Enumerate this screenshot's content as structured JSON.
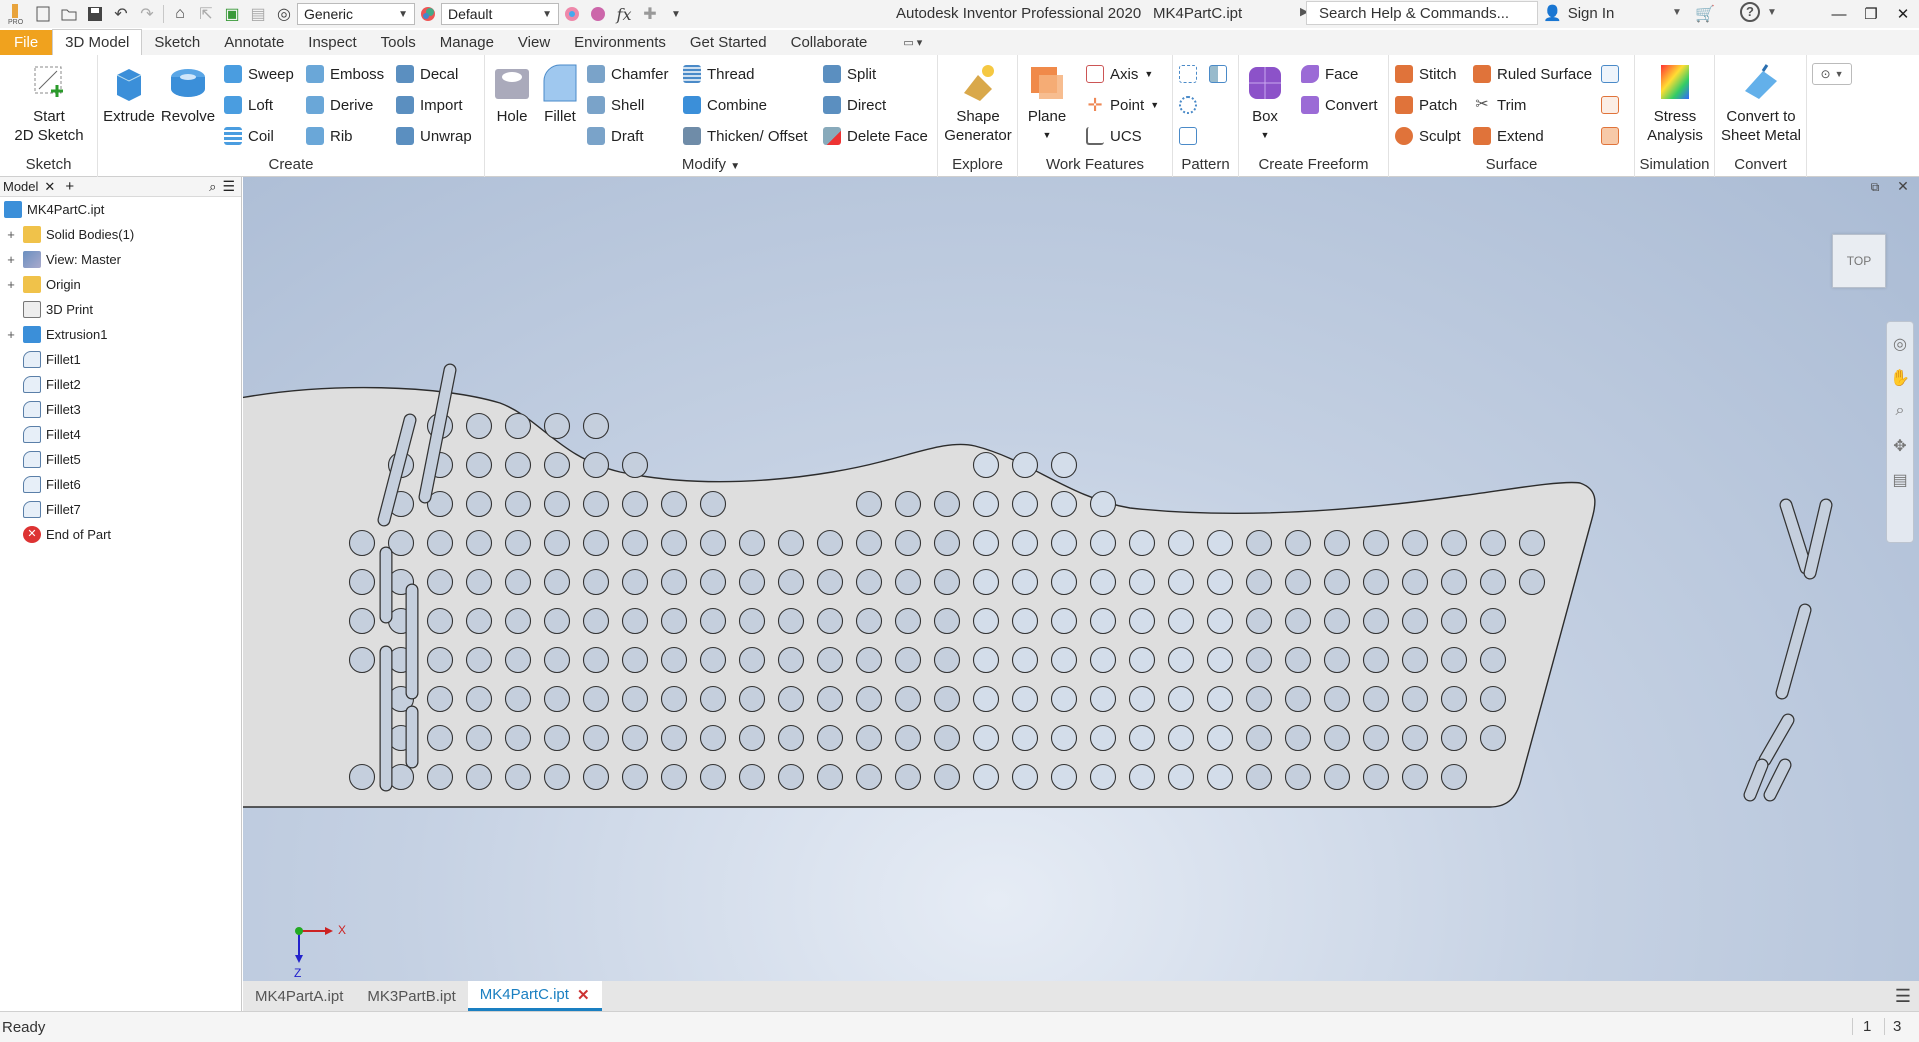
{
  "titlebar": {
    "app_icon": "inventor-logo-icon",
    "style_dropdown": "Generic",
    "appearance_dropdown": "Default",
    "app_title": "Autodesk Inventor Professional 2020",
    "doc_title": "MK4PartC.ipt",
    "search_placeholder": "Search Help & Commands...",
    "signin": "Sign In"
  },
  "tabs": [
    "File",
    "3D Model",
    "Sketch",
    "Annotate",
    "Inspect",
    "Tools",
    "Manage",
    "View",
    "Environments",
    "Get Started",
    "Collaborate"
  ],
  "active_tab": "3D Model",
  "ribbon": {
    "sketch": {
      "title": "Sketch",
      "start": "Start",
      "start2": "2D Sketch"
    },
    "create": {
      "title": "Create",
      "extrude": "Extrude",
      "revolve": "Revolve",
      "col1": [
        "Sweep",
        "Loft",
        "Coil"
      ],
      "col2": [
        "Emboss",
        "Derive",
        "Rib"
      ],
      "col3": [
        "Decal",
        "Import",
        "Unwrap"
      ]
    },
    "modify": {
      "title": "Modify",
      "hole": "Hole",
      "fillet": "Fillet",
      "col1": [
        "Chamfer",
        "Shell",
        "Draft"
      ],
      "col2": [
        "Thread",
        "Combine",
        "Thicken/ Offset"
      ],
      "col3": [
        "Split",
        "Direct",
        "Delete Face"
      ]
    },
    "explore": {
      "title": "Explore",
      "shape1": "Shape",
      "shape2": "Generator"
    },
    "work": {
      "title": "Work Features",
      "plane": "Plane",
      "col": [
        "Axis",
        "Point",
        "UCS"
      ]
    },
    "pattern": {
      "title": "Pattern"
    },
    "freeform": {
      "title": "Create Freeform",
      "box": "Box",
      "col": [
        "Face",
        "Convert"
      ]
    },
    "surface": {
      "title": "Surface",
      "col1": [
        "Stitch",
        "Patch",
        "Sculpt"
      ],
      "col2": [
        "Ruled Surface",
        "Trim",
        "Extend"
      ]
    },
    "simulation": {
      "title": "Simulation",
      "l1": "Stress",
      "l2": "Analysis"
    },
    "convert": {
      "title": "Convert",
      "l1": "Convert to",
      "l2": "Sheet Metal"
    }
  },
  "browser": {
    "tab_label": "Model",
    "items": [
      {
        "label": "MK4PartC.ipt",
        "expander": "",
        "icon": "part-icon"
      },
      {
        "label": "Solid Bodies(1)",
        "expander": "+",
        "icon": "folder-icon"
      },
      {
        "label": "View: Master",
        "expander": "+",
        "icon": "view-icon"
      },
      {
        "label": "Origin",
        "expander": "+",
        "icon": "folder-icon"
      },
      {
        "label": "3D Print",
        "expander": "",
        "icon": "print-icon"
      },
      {
        "label": "Extrusion1",
        "expander": "+",
        "icon": "extrusion-icon"
      },
      {
        "label": "Fillet1",
        "expander": "",
        "icon": "fillet-icon"
      },
      {
        "label": "Fillet2",
        "expander": "",
        "icon": "fillet-icon"
      },
      {
        "label": "Fillet3",
        "expander": "",
        "icon": "fillet-icon"
      },
      {
        "label": "Fillet4",
        "expander": "",
        "icon": "fillet-icon"
      },
      {
        "label": "Fillet5",
        "expander": "",
        "icon": "fillet-icon"
      },
      {
        "label": "Fillet6",
        "expander": "",
        "icon": "fillet-icon"
      },
      {
        "label": "Fillet7",
        "expander": "",
        "icon": "fillet-icon"
      },
      {
        "label": "End of Part",
        "expander": "",
        "icon": "end-of-part-icon"
      }
    ]
  },
  "viewport": {
    "viewcube": "TOP",
    "axis_x": "X",
    "axis_z": "Z"
  },
  "doc_tabs": [
    "MK4PartA.ipt",
    "MK3PartB.ipt",
    "MK4PartC.ipt"
  ],
  "active_doc": "MK4PartC.ipt",
  "status": {
    "text": "Ready",
    "n1": "1",
    "n2": "3"
  },
  "colors": {
    "file_tab": "#f0a21e",
    "accent": "#1a7fc1",
    "part_fill": "#dedede"
  }
}
